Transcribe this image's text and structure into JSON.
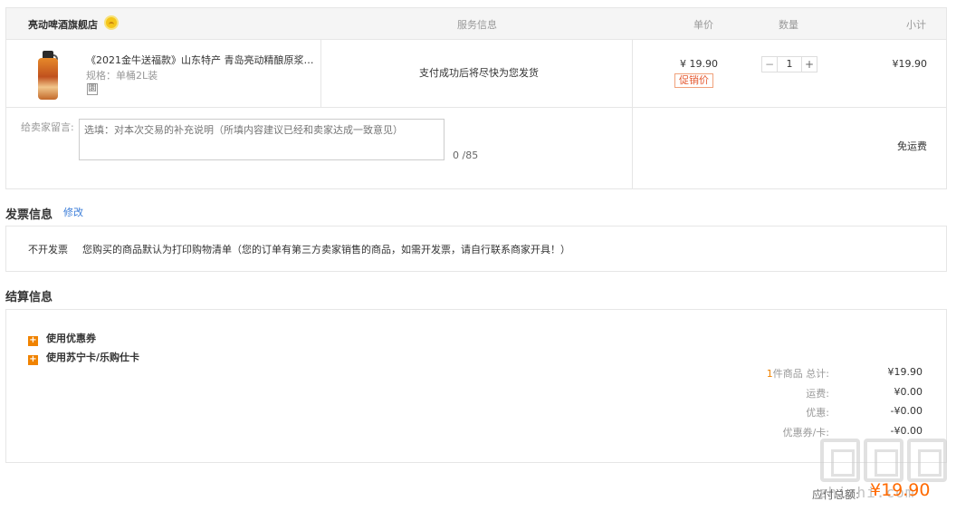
{
  "header": {
    "store_name": "亮动啤酒旗舰店",
    "col_service": "服务信息",
    "col_price": "单价",
    "col_qty": "数量",
    "col_subtotal": "小计"
  },
  "item": {
    "title": "《2021金牛送福款》山东特产 青岛亮动精酿原浆啤...",
    "spec": "规格：单桶2L装",
    "tag_glyph": "圜",
    "service": "支付成功后将尽快为您发货",
    "price": "¥ 19.90",
    "promo_badge": "促销价",
    "qty_minus": "−",
    "qty_value": "1",
    "qty_plus": "+",
    "subtotal": "¥19.90"
  },
  "message": {
    "label": "给卖家留言:",
    "placeholder": "选填：对本次交易的补充说明（所填内容建议已经和卖家达成一致意见）",
    "counter": "0 /85",
    "shipping": "免运费"
  },
  "invoice": {
    "section_title": "发票信息",
    "edit_label": "修改",
    "type": "不开发票",
    "description": "您购买的商品默认为打印购物清单（您的订单有第三方卖家销售的商品，如需开发票，请自行联系商家开具！）"
  },
  "settlement": {
    "section_title": "结算信息",
    "options": [
      {
        "label": "使用优惠券"
      },
      {
        "label": "使用苏宁卡/乐购仕卡"
      }
    ],
    "summary": {
      "count_num": "1",
      "count_label": "件商品 总计:",
      "total": "¥19.90",
      "shipping_label": "运费:",
      "shipping": "¥0.00",
      "discount_label": "优惠:",
      "discount": "-¥0.00",
      "coupon_label": "优惠券/卡:",
      "coupon": "-¥0.00"
    },
    "pay_label": "应付总额:",
    "pay_total": "¥19.90"
  },
  "watermark": {
    "text": "zhizhi.com"
  },
  "colors": {
    "accent": "#ff6a00",
    "link": "#3b7dd8",
    "border": "#e6e6e6",
    "header_bg": "#f5f5f5",
    "option_icon": "#f08300"
  }
}
